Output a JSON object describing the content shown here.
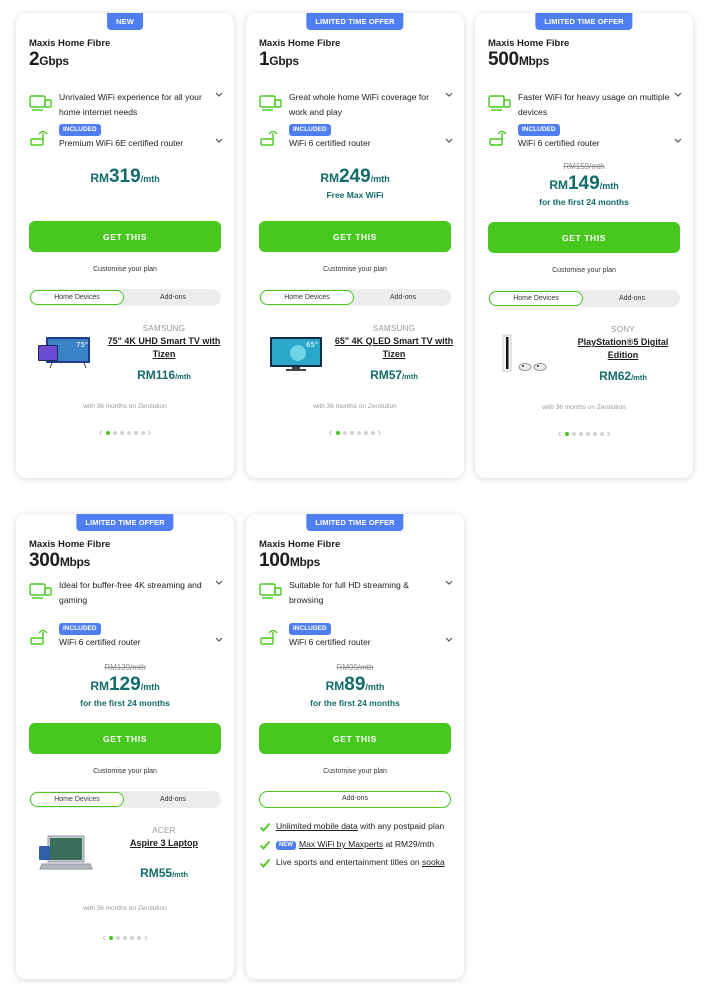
{
  "common": {
    "brand": "Maxis Home Fibre",
    "included": "INCLUDED",
    "cta": "GET THIS",
    "customise": "Customise your plan",
    "tab_devices": "Home Devices",
    "tab_addons": "Add-ons",
    "zerolution": "with 36 months on Zerolution",
    "currency": "RM",
    "per_month": "/mth",
    "accent_green": "#48c81e",
    "badge_blue": "#4f7ef0",
    "price_teal": "#136b6b"
  },
  "plans": [
    {
      "badge": "NEW",
      "speed_num": "2",
      "speed_unit": "Gbps",
      "feature": "Unrivaled WiFi experience for all your home internet needs",
      "router": "Premium WiFi 6E certified router",
      "old_price": "",
      "price": "319",
      "price_note": "",
      "device": {
        "brand": "SAMSUNG",
        "name": "75\" 4K UHD Smart TV with Tizen",
        "price": "116",
        "icon": "tv-icon",
        "screen_label": "75\""
      }
    },
    {
      "badge": "LIMITED TIME OFFER",
      "speed_num": "1",
      "speed_unit": "Gbps",
      "feature": "Great whole home WiFi coverage for work and play",
      "router": "WiFi 6 certified router",
      "old_price": "",
      "price": "249",
      "price_note": "Free Max WiFi",
      "device": {
        "brand": "SAMSUNG",
        "name": "65\" 4K QLED Smart TV with Tizen",
        "price": "57",
        "icon": "tv-icon",
        "screen_label": "65\""
      }
    },
    {
      "badge": "LIMITED TIME OFFER",
      "speed_num": "500",
      "speed_unit": "Mbps",
      "feature": "Faster WiFi for heavy usage on multiple devices",
      "router": "WiFi 6 certified router",
      "old_price": "RM159/mth",
      "price": "149",
      "price_note": "for the first 24 months",
      "device": {
        "brand": "SONY",
        "name": "PlayStation®5 Digital Edition",
        "price": "62",
        "icon": "console-icon"
      }
    },
    {
      "badge": "LIMITED TIME OFFER",
      "speed_num": "300",
      "speed_unit": "Mbps",
      "feature": "Ideal for buffer-free 4K streaming and gaming",
      "router": "WiFi 6 certified router",
      "old_price": "RM139/mth",
      "price": "129",
      "price_note": "for the first 24 months",
      "device": {
        "brand": "ACER",
        "name": "Aspire 3 Laptop",
        "price": "55",
        "icon": "laptop-icon"
      }
    },
    {
      "badge": "LIMITED TIME OFFER",
      "speed_num": "100",
      "speed_unit": "Mbps",
      "feature": "Suitable for full HD streaming & browsing",
      "router": "WiFi 6 certified router",
      "old_price": "RM99/mth",
      "price": "89",
      "price_note": "for the first 24 months",
      "addons": {
        "item1_link": "Unlimited mobile data",
        "item1_rest": " with any postpaid plan",
        "item2_tag": "NEW",
        "item2_link": "Max WiFi by Maxperts",
        "item2_rest": " at RM29/mth",
        "item3_text": "Live sports and entertainment titles on ",
        "item3_link": "sooka"
      }
    }
  ]
}
